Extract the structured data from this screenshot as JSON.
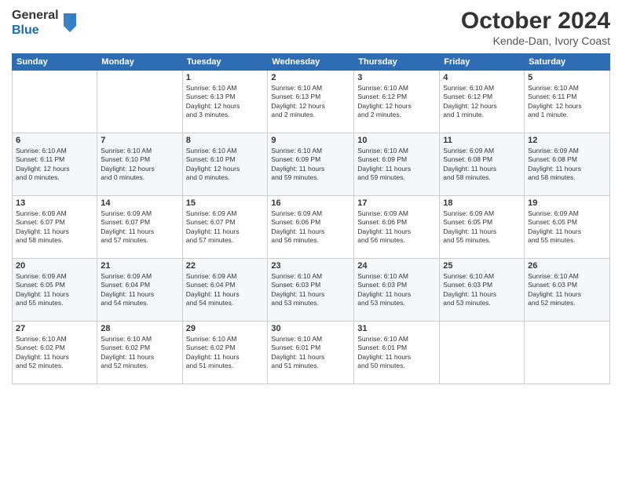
{
  "header": {
    "logo_general": "General",
    "logo_blue": "Blue",
    "month": "October 2024",
    "location": "Kende-Dan, Ivory Coast"
  },
  "weekdays": [
    "Sunday",
    "Monday",
    "Tuesday",
    "Wednesday",
    "Thursday",
    "Friday",
    "Saturday"
  ],
  "weeks": [
    [
      {
        "day": "",
        "info": ""
      },
      {
        "day": "",
        "info": ""
      },
      {
        "day": "1",
        "info": "Sunrise: 6:10 AM\nSunset: 6:13 PM\nDaylight: 12 hours\nand 3 minutes."
      },
      {
        "day": "2",
        "info": "Sunrise: 6:10 AM\nSunset: 6:13 PM\nDaylight: 12 hours\nand 2 minutes."
      },
      {
        "day": "3",
        "info": "Sunrise: 6:10 AM\nSunset: 6:12 PM\nDaylight: 12 hours\nand 2 minutes."
      },
      {
        "day": "4",
        "info": "Sunrise: 6:10 AM\nSunset: 6:12 PM\nDaylight: 12 hours\nand 1 minute."
      },
      {
        "day": "5",
        "info": "Sunrise: 6:10 AM\nSunset: 6:11 PM\nDaylight: 12 hours\nand 1 minute."
      }
    ],
    [
      {
        "day": "6",
        "info": "Sunrise: 6:10 AM\nSunset: 6:11 PM\nDaylight: 12 hours\nand 0 minutes."
      },
      {
        "day": "7",
        "info": "Sunrise: 6:10 AM\nSunset: 6:10 PM\nDaylight: 12 hours\nand 0 minutes."
      },
      {
        "day": "8",
        "info": "Sunrise: 6:10 AM\nSunset: 6:10 PM\nDaylight: 12 hours\nand 0 minutes."
      },
      {
        "day": "9",
        "info": "Sunrise: 6:10 AM\nSunset: 6:09 PM\nDaylight: 11 hours\nand 59 minutes."
      },
      {
        "day": "10",
        "info": "Sunrise: 6:10 AM\nSunset: 6:09 PM\nDaylight: 11 hours\nand 59 minutes."
      },
      {
        "day": "11",
        "info": "Sunrise: 6:09 AM\nSunset: 6:08 PM\nDaylight: 11 hours\nand 58 minutes."
      },
      {
        "day": "12",
        "info": "Sunrise: 6:09 AM\nSunset: 6:08 PM\nDaylight: 11 hours\nand 58 minutes."
      }
    ],
    [
      {
        "day": "13",
        "info": "Sunrise: 6:09 AM\nSunset: 6:07 PM\nDaylight: 11 hours\nand 58 minutes."
      },
      {
        "day": "14",
        "info": "Sunrise: 6:09 AM\nSunset: 6:07 PM\nDaylight: 11 hours\nand 57 minutes."
      },
      {
        "day": "15",
        "info": "Sunrise: 6:09 AM\nSunset: 6:07 PM\nDaylight: 11 hours\nand 57 minutes."
      },
      {
        "day": "16",
        "info": "Sunrise: 6:09 AM\nSunset: 6:06 PM\nDaylight: 11 hours\nand 56 minutes."
      },
      {
        "day": "17",
        "info": "Sunrise: 6:09 AM\nSunset: 6:06 PM\nDaylight: 11 hours\nand 56 minutes."
      },
      {
        "day": "18",
        "info": "Sunrise: 6:09 AM\nSunset: 6:05 PM\nDaylight: 11 hours\nand 55 minutes."
      },
      {
        "day": "19",
        "info": "Sunrise: 6:09 AM\nSunset: 6:05 PM\nDaylight: 11 hours\nand 55 minutes."
      }
    ],
    [
      {
        "day": "20",
        "info": "Sunrise: 6:09 AM\nSunset: 6:05 PM\nDaylight: 11 hours\nand 55 minutes."
      },
      {
        "day": "21",
        "info": "Sunrise: 6:09 AM\nSunset: 6:04 PM\nDaylight: 11 hours\nand 54 minutes."
      },
      {
        "day": "22",
        "info": "Sunrise: 6:09 AM\nSunset: 6:04 PM\nDaylight: 11 hours\nand 54 minutes."
      },
      {
        "day": "23",
        "info": "Sunrise: 6:10 AM\nSunset: 6:03 PM\nDaylight: 11 hours\nand 53 minutes."
      },
      {
        "day": "24",
        "info": "Sunrise: 6:10 AM\nSunset: 6:03 PM\nDaylight: 11 hours\nand 53 minutes."
      },
      {
        "day": "25",
        "info": "Sunrise: 6:10 AM\nSunset: 6:03 PM\nDaylight: 11 hours\nand 53 minutes."
      },
      {
        "day": "26",
        "info": "Sunrise: 6:10 AM\nSunset: 6:03 PM\nDaylight: 11 hours\nand 52 minutes."
      }
    ],
    [
      {
        "day": "27",
        "info": "Sunrise: 6:10 AM\nSunset: 6:02 PM\nDaylight: 11 hours\nand 52 minutes."
      },
      {
        "day": "28",
        "info": "Sunrise: 6:10 AM\nSunset: 6:02 PM\nDaylight: 11 hours\nand 52 minutes."
      },
      {
        "day": "29",
        "info": "Sunrise: 6:10 AM\nSunset: 6:02 PM\nDaylight: 11 hours\nand 51 minutes."
      },
      {
        "day": "30",
        "info": "Sunrise: 6:10 AM\nSunset: 6:01 PM\nDaylight: 11 hours\nand 51 minutes."
      },
      {
        "day": "31",
        "info": "Sunrise: 6:10 AM\nSunset: 6:01 PM\nDaylight: 11 hours\nand 50 minutes."
      },
      {
        "day": "",
        "info": ""
      },
      {
        "day": "",
        "info": ""
      }
    ]
  ]
}
